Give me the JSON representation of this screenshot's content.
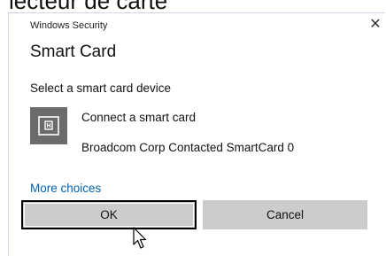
{
  "background": {
    "caption": "lecteur de carte"
  },
  "dialog": {
    "title": "Windows Security",
    "close_glyph": "✕",
    "heading": "Smart Card",
    "subtitle": "Select a smart card device",
    "device": {
      "icon": "smart-card-icon",
      "line1": "Connect a smart card",
      "line2": "Broadcom Corp Contacted SmartCard 0"
    },
    "more_choices": "More choices",
    "buttons": {
      "ok": "OK",
      "cancel": "Cancel"
    }
  },
  "colors": {
    "link": "#0063b1",
    "tile": "#6b6b6b",
    "button": "#cccccc"
  }
}
